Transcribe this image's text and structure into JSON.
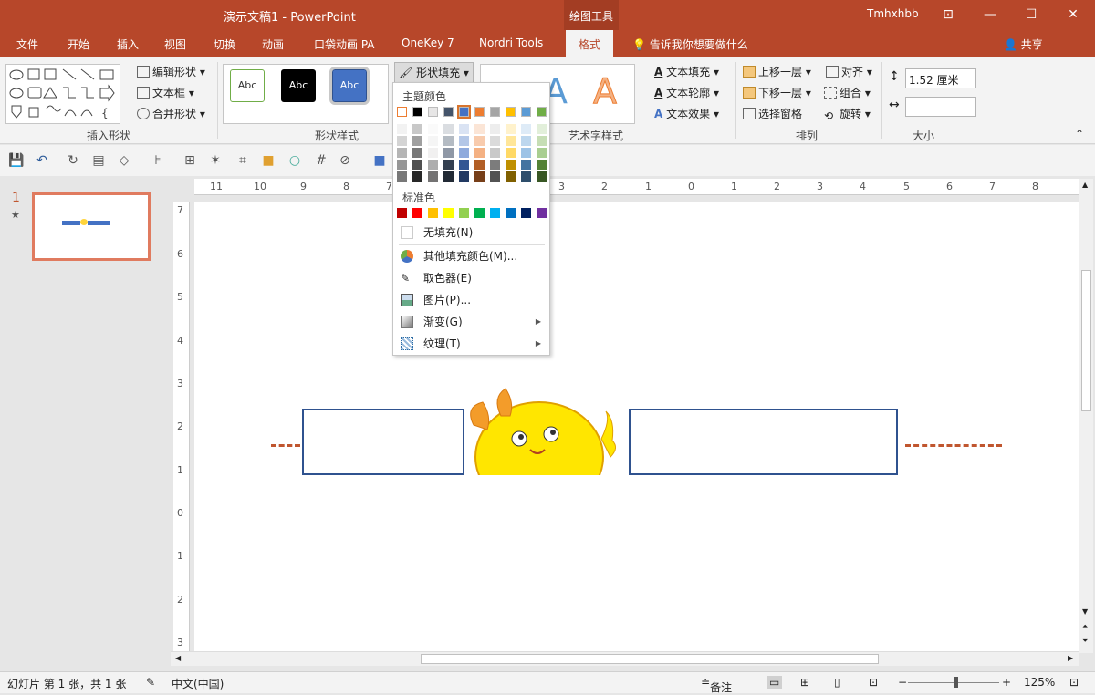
{
  "title": "演示文稿1 - PowerPoint",
  "context_tab": "绘图工具",
  "user": "Tmhxhbb",
  "window_icons": [
    "ribbon-display-icon",
    "minimize-icon",
    "restore-icon",
    "close-icon"
  ],
  "tabs": [
    "文件",
    "开始",
    "插入",
    "视图",
    "切换",
    "动画",
    "口袋动画 PA",
    "OneKey 7",
    "Nordri Tools",
    "格式"
  ],
  "tell_me": "告诉我你想要做什么",
  "share": "共享",
  "ribbon": {
    "edit_shape": "编辑形状",
    "textbox": "文本框",
    "merge_shapes": "合并形状",
    "insert_shapes_label": "插入形状",
    "style_sample": "Abc",
    "shape_styles_label": "形状样式",
    "shape_fill": "形状填充",
    "text_fill": "文本填充",
    "text_outline": "文本轮廓",
    "text_effects": "文本效果",
    "wordart_label": "艺术字样式",
    "wordart_letter": "A",
    "bring_forward": "上移一层",
    "send_backward": "下移一层",
    "selection_pane": "选择窗格",
    "align": "对齐",
    "group": "组合",
    "rotate": "旋转",
    "arrange_label": "排列",
    "height_value": "1.52 厘米",
    "width_value": "",
    "size_label": "大小"
  },
  "dropdown": {
    "theme_colors_label": "主题颜色",
    "standard_colors_label": "标准色",
    "theme_colors": [
      "#ffffff",
      "#000000",
      "#e7e6e6",
      "#44546a",
      "#4472c4",
      "#ed7d31",
      "#a5a5a5",
      "#ffc000",
      "#5b9bd5",
      "#70ad47"
    ],
    "standard_colors": [
      "#c00000",
      "#ff0000",
      "#ffc000",
      "#ffff00",
      "#92d050",
      "#00b050",
      "#00b0f0",
      "#0070c0",
      "#002060",
      "#7030a0"
    ],
    "no_fill": "无填充(N)",
    "more_colors": "其他填充颜色(M)...",
    "eyedropper": "取色器(E)",
    "picture": "图片(P)...",
    "gradient": "渐变(G)",
    "texture": "纹理(T)"
  },
  "slide_number": "1",
  "slide_star": "★",
  "ruler_h": [
    "11",
    "10",
    "9",
    "8",
    "7",
    "3",
    "2",
    "1",
    "0",
    "1",
    "2",
    "3",
    "4",
    "5",
    "6",
    "7",
    "8"
  ],
  "ruler_v": [
    "7",
    "6",
    "5",
    "4",
    "3",
    "2",
    "1",
    "0",
    "1",
    "2",
    "3"
  ],
  "status": {
    "slide_info": "幻灯片 第 1 张，共 1 张",
    "language": "中文(中国)",
    "notes": "备注",
    "zoom": "125%"
  }
}
